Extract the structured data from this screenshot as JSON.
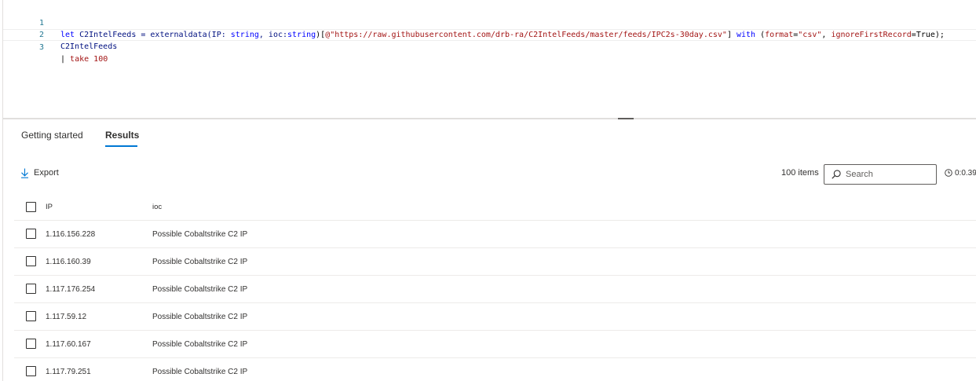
{
  "editor": {
    "lines": [
      {
        "number": "1",
        "tokens": {
          "t1": "let ",
          "t2": "C2IntelFeeds = ",
          "t3": "externaldata",
          "t4": "(IP: ",
          "t5": "string",
          "t6": ", ioc:",
          "t7": "string",
          "t8": ")[",
          "t9": "@\"https://raw.githubusercontent.com/drb-ra/C2IntelFeeds/master/feeds/IPC2s-30day.csv\"",
          "t10": "] ",
          "t11": "with",
          "t12": " (",
          "t13": "format",
          "t14": "=",
          "t15": "\"csv\"",
          "t16": ", ",
          "t17": "ignoreFirstRecord",
          "t18": "=True);"
        }
      },
      {
        "number": "2",
        "tokens": {
          "t1": "C2IntelFeeds"
        }
      },
      {
        "number": "3",
        "tokens": {
          "t1": "| ",
          "t2": "take",
          "t3": " ",
          "t4": "100"
        }
      }
    ]
  },
  "tabs": {
    "getting_started": "Getting started",
    "results": "Results"
  },
  "toolbar": {
    "export_label": "Export",
    "items_count": "100 items",
    "search_placeholder": "Search",
    "elapsed": "0:0.39"
  },
  "grid": {
    "columns": [
      "IP",
      "ioc"
    ],
    "rows": [
      {
        "ip": "1.116.156.228",
        "ioc": "Possible Cobaltstrike C2 IP"
      },
      {
        "ip": "1.116.160.39",
        "ioc": "Possible Cobaltstrike C2 IP"
      },
      {
        "ip": "1.117.176.254",
        "ioc": "Possible Cobaltstrike C2 IP"
      },
      {
        "ip": "1.117.59.12",
        "ioc": "Possible Cobaltstrike C2 IP"
      },
      {
        "ip": "1.117.60.167",
        "ioc": "Possible Cobaltstrike C2 IP"
      },
      {
        "ip": "1.117.79.251",
        "ioc": "Possible Cobaltstrike C2 IP"
      }
    ]
  },
  "colors": {
    "accent": "#0078d4",
    "line_number": "#237893",
    "keyword": "#0000ff",
    "string": "#a31515",
    "number": "#098658"
  }
}
